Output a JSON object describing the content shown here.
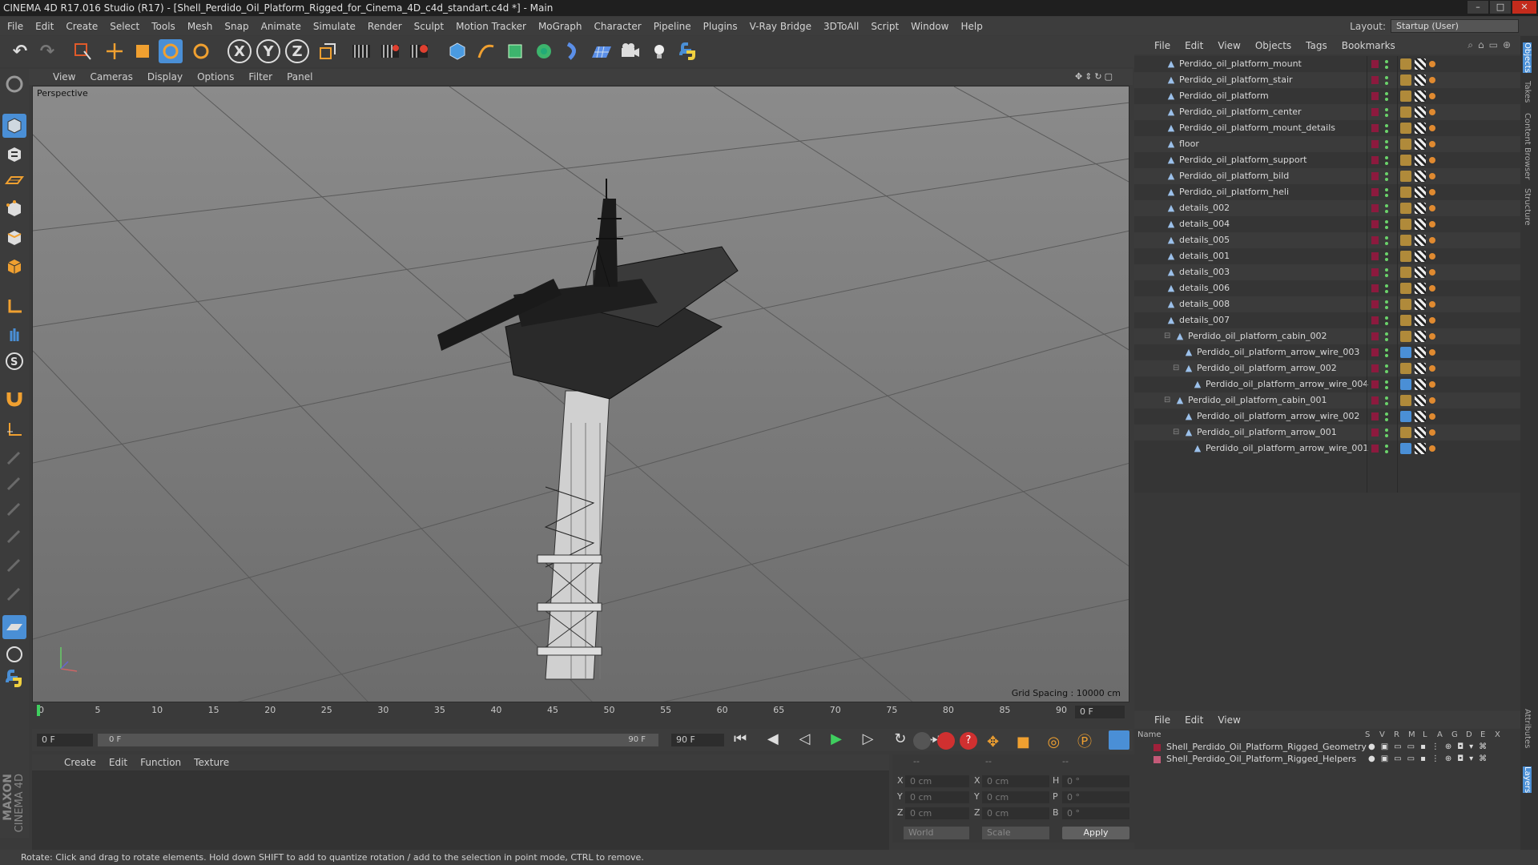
{
  "app": {
    "title": "CINEMA 4D R17.016 Studio (R17) - [Shell_Perdido_Oil_Platform_Rigged_for_Cinema_4D_c4d_standart.c4d *] - Main",
    "win_min": "–",
    "win_max": "□",
    "win_close": "✕"
  },
  "menu": [
    "File",
    "Edit",
    "Create",
    "Select",
    "Tools",
    "Mesh",
    "Snap",
    "Animate",
    "Simulate",
    "Render",
    "Sculpt",
    "Motion Tracker",
    "MoGraph",
    "Character",
    "Pipeline",
    "Plugins",
    "V-Ray Bridge",
    "3DToAll",
    "Script",
    "Window",
    "Help"
  ],
  "layout": {
    "label": "Layout:",
    "value": "Startup (User)"
  },
  "toolbar": {
    "undo": "↶",
    "redo": "↷",
    "x_axis": "X",
    "y_axis": "Y",
    "z_axis": "Z"
  },
  "viewport": {
    "menu": [
      "View",
      "Cameras",
      "Display",
      "Options",
      "Filter",
      "Panel"
    ],
    "camera": "Perspective",
    "grid_spacing": "Grid Spacing : 10000 cm"
  },
  "timeline": {
    "ticks": [
      "0",
      "5",
      "10",
      "15",
      "20",
      "25",
      "30",
      "35",
      "40",
      "45",
      "50",
      "55",
      "60",
      "65",
      "70",
      "75",
      "80",
      "85",
      "90"
    ],
    "current_frame": "0 F",
    "start_field": "0 F",
    "range_start": "0 F",
    "range_end": "90 F",
    "end_field": "90 F"
  },
  "materials": {
    "menu": [
      "Create",
      "Edit",
      "Function",
      "Texture"
    ]
  },
  "coords": {
    "headers": [
      "--",
      "--",
      "--"
    ],
    "x_pos": "0 cm",
    "y_pos": "0 cm",
    "z_pos": "0 cm",
    "x_size": "0 cm",
    "y_size": "0 cm",
    "z_size": "0 cm",
    "h": "0 °",
    "p": "0 °",
    "b": "0 °",
    "labels": {
      "x": "X",
      "y": "Y",
      "z": "Z",
      "x2": "X",
      "y2": "Y",
      "z2": "Z",
      "h": "H",
      "p": "P",
      "b": "B"
    },
    "mode": "World",
    "size_mode": "Scale",
    "apply": "Apply"
  },
  "objects_panel": {
    "menu": [
      "File",
      "Edit",
      "View",
      "Objects",
      "Tags",
      "Bookmarks"
    ],
    "items": [
      {
        "name": "Perdido_oil_platform_mount",
        "indent": 0
      },
      {
        "name": "Perdido_oil_platform_stair",
        "indent": 0
      },
      {
        "name": "Perdido_oil_platform",
        "indent": 0
      },
      {
        "name": "Perdido_oil_platform_center",
        "indent": 0
      },
      {
        "name": "Perdido_oil_platform_mount_details",
        "indent": 0
      },
      {
        "name": "floor",
        "indent": 0
      },
      {
        "name": "Perdido_oil_platform_support",
        "indent": 0
      },
      {
        "name": "Perdido_oil_platform_bild",
        "indent": 0
      },
      {
        "name": "Perdido_oil_platform_heli",
        "indent": 0
      },
      {
        "name": "details_002",
        "indent": 0
      },
      {
        "name": "details_004",
        "indent": 0
      },
      {
        "name": "details_005",
        "indent": 0
      },
      {
        "name": "details_001",
        "indent": 0
      },
      {
        "name": "details_003",
        "indent": 0
      },
      {
        "name": "details_006",
        "indent": 0
      },
      {
        "name": "details_008",
        "indent": 0
      },
      {
        "name": "details_007",
        "indent": 0
      },
      {
        "name": "Perdido_oil_platform_cabin_002",
        "indent": 1
      },
      {
        "name": "Perdido_oil_platform_arrow_wire_003",
        "indent": 2
      },
      {
        "name": "Perdido_oil_platform_arrow_002",
        "indent": 2
      },
      {
        "name": "Perdido_oil_platform_arrow_wire_004",
        "indent": 3
      },
      {
        "name": "Perdido_oil_platform_cabin_001",
        "indent": 1
      },
      {
        "name": "Perdido_oil_platform_arrow_wire_002",
        "indent": 2
      },
      {
        "name": "Perdido_oil_platform_arrow_001",
        "indent": 2
      },
      {
        "name": "Perdido_oil_platform_arrow_wire_001",
        "indent": 3
      }
    ]
  },
  "layers_panel": {
    "menu": [
      "File",
      "Edit",
      "View"
    ],
    "col_name": "Name",
    "cols": [
      "S",
      "V",
      "R",
      "M",
      "L",
      "A",
      "G",
      "D",
      "E",
      "X"
    ],
    "items": [
      {
        "name": "Shell_Perdido_Oil_Platform_Rigged_Geometry",
        "color": "#a0203a"
      },
      {
        "name": "Shell_Perdido_Oil_Platform_Rigged_Helpers",
        "color": "#c45a78"
      }
    ]
  },
  "right_tabs": [
    "Objects",
    "Takes",
    "Content Browser",
    "Structure",
    "Attributes",
    "Layers"
  ],
  "status": "Rotate: Click and drag to rotate elements. Hold down SHIFT to add to quantize rotation / add to the selection in point mode, CTRL to remove.",
  "brand": {
    "maxon": "MAXON",
    "product": "CINEMA 4D"
  },
  "colors": {
    "accent": "#4a8fd6",
    "material_swatch": "#8c1a3e"
  }
}
